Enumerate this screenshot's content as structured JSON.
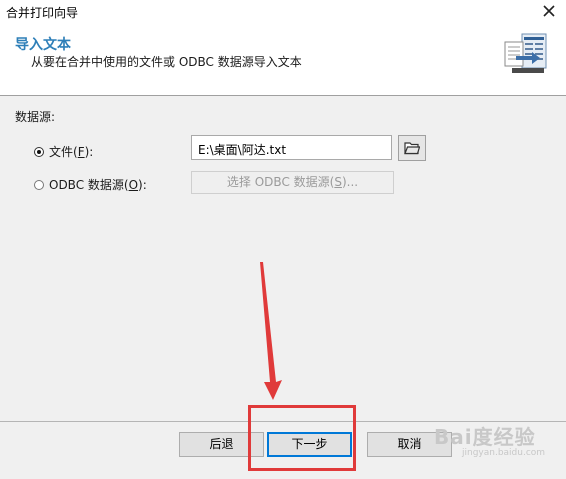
{
  "window": {
    "title": "合并打印向导"
  },
  "header": {
    "title": "导入文本",
    "subtitle": "从要在合并中使用的文件或 ODBC 数据源导入文本",
    "icon": "import-text-icon"
  },
  "body": {
    "section_label": "数据源:",
    "file_option": {
      "text_before": "文件(",
      "accelerator": "F",
      "text_after": "):",
      "selected": true
    },
    "file_path": "E:\\桌面\\阿达.txt",
    "odbc_option": {
      "text_before": "ODBC 数据源(",
      "accelerator": "O",
      "text_after": "):",
      "selected": false
    },
    "odbc_button": {
      "text_before": "选择 ODBC 数据源(",
      "accelerator": "S",
      "text_after": ")..."
    }
  },
  "footer": {
    "back_label": "后退",
    "next_label": "下一步",
    "cancel_label": "取消"
  },
  "watermark": {
    "text": "Bai度经验",
    "sub": "jingyan.baidu.com"
  },
  "colors": {
    "header_title": "#2e7fb8",
    "annotation_red": "#e03a3a",
    "primary_focus": "#0078d7"
  }
}
